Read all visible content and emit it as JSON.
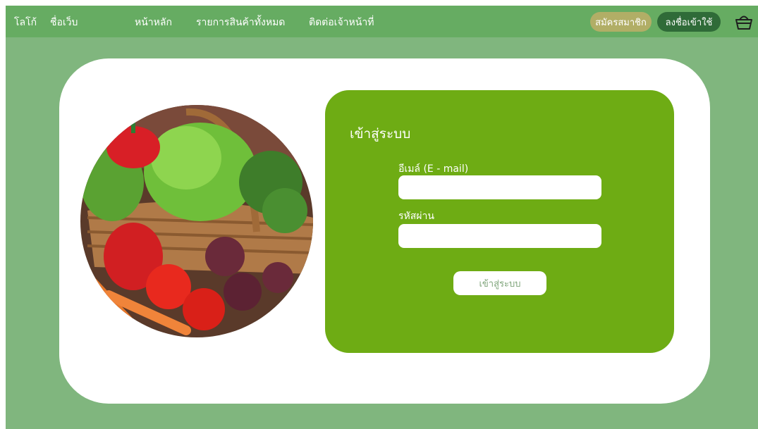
{
  "nav": {
    "logo": "โลโก้",
    "site_name": "ชื่อเว็บ",
    "links": [
      "หน้าหลัก",
      "รายการสินค้าทั้งหมด",
      "ติดต่อเจ้าหน้าที่"
    ],
    "register": "สมัครสมาชิก",
    "login": "ลงชื่อเข้าใช้"
  },
  "login": {
    "title": "เข้าสู่ระบบ",
    "email_label": "อีเมล์ (E - mail)",
    "email_value": "",
    "password_label": "รหัสผ่าน",
    "password_value": "",
    "submit": "เข้าสู่ระบบ"
  },
  "colors": {
    "nav": "#66ac62",
    "background": "#80b67e",
    "panel": "#6eac14",
    "register_button": "#b1ae66",
    "login_button": "#2f6b38"
  },
  "icons": [
    "basket-icon"
  ]
}
